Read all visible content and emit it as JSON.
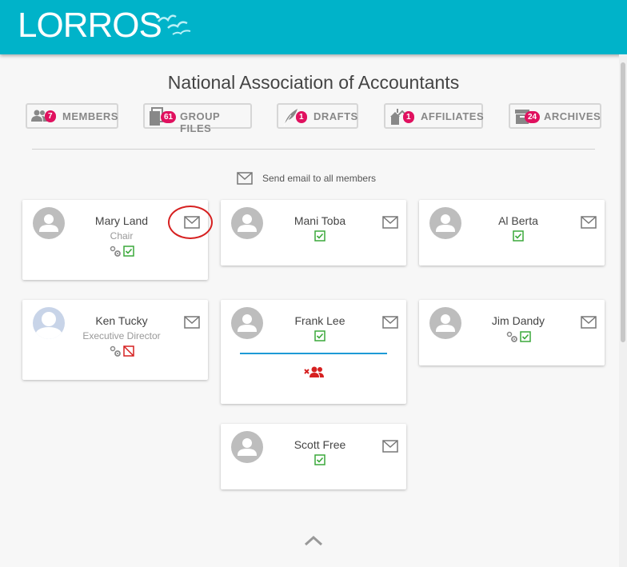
{
  "app": {
    "logo_text": "LORROS"
  },
  "page_title": "National Association of Accountants",
  "tabs": [
    {
      "label": "MEMBERS",
      "count": "7",
      "icon": "members-icon"
    },
    {
      "label": "GROUP FILES",
      "count": "61",
      "icon": "files-icon"
    },
    {
      "label": "DRAFTS",
      "count": "1",
      "icon": "feather-icon"
    },
    {
      "label": "AFFILIATES",
      "count": "1",
      "icon": "affiliates-icon"
    },
    {
      "label": "ARCHIVES",
      "count": "24",
      "icon": "archive-icon"
    }
  ],
  "send_all_label": "Send email to all members",
  "members": [
    {
      "name": "Mary Land",
      "role": "Chair",
      "status": "admin-verified"
    },
    {
      "name": "Mani Toba",
      "role": "",
      "status": "verified"
    },
    {
      "name": "Al Berta",
      "role": "",
      "status": "verified"
    },
    {
      "name": "Ken Tucky",
      "role": "Executive Director",
      "status": "admin-unverified"
    },
    {
      "name": "Frank Lee",
      "role": "",
      "status": "verified-removed"
    },
    {
      "name": "Jim Dandy",
      "role": "",
      "status": "admin-verified"
    },
    {
      "name": "Scott Free",
      "role": "",
      "status": "verified"
    }
  ],
  "colors": {
    "header": "#00b3c9",
    "badge": "#e0115f",
    "check": "#3aa83a",
    "uncheck": "#d62020",
    "divider_accent": "#1e9ad6"
  }
}
